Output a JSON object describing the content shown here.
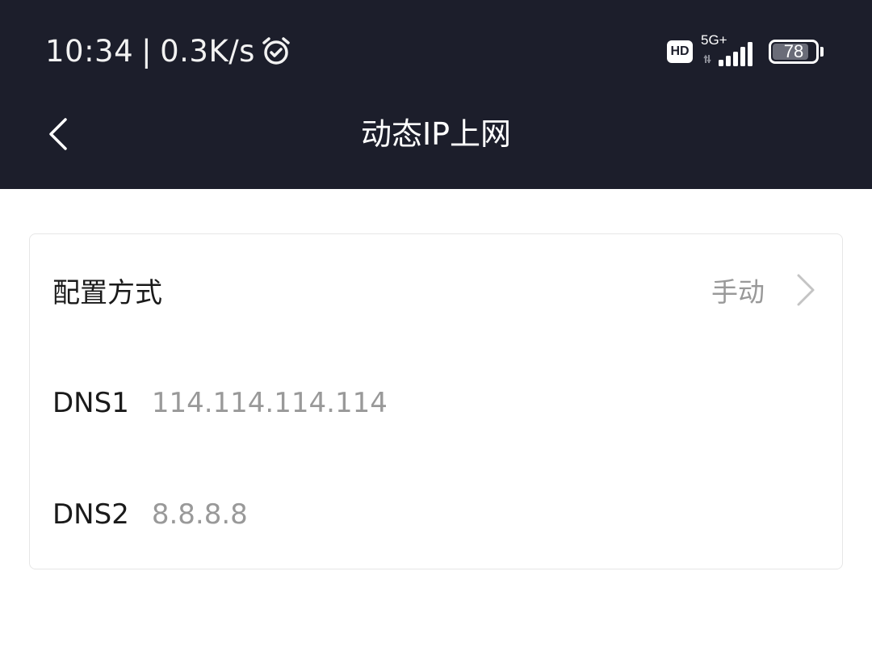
{
  "status_bar": {
    "time": "10:34",
    "separator": "|",
    "net_speed": "0.3K/s",
    "hd_badge": "HD",
    "network_type": "5G+",
    "battery_level": "78",
    "icons": [
      "alarm-icon",
      "hd-icon",
      "signal-icon",
      "battery-icon"
    ]
  },
  "nav": {
    "title": "动态IP上网",
    "back_icon": "chevron-left-icon"
  },
  "settings": {
    "config_mode": {
      "label": "配置方式",
      "value": "手动",
      "icon": "chevron-right-icon"
    },
    "dns1": {
      "label": "DNS1",
      "value": "114.114.114.114"
    },
    "dns2": {
      "label": "DNS2",
      "value": "8.8.8.8"
    }
  },
  "colors": {
    "header_bg": "#1c1e2b",
    "text_primary": "#1a1a1a",
    "text_secondary": "#999999"
  }
}
